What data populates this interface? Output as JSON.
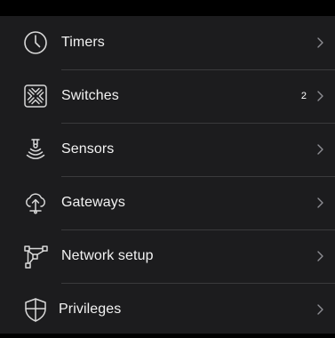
{
  "colors": {
    "background": "#1c1c1e",
    "text": "#f2f2f2",
    "icon": "#d8d8d8",
    "chevron": "#8e8e93",
    "divider": "#3a3a3c"
  },
  "menu": {
    "items": [
      {
        "label": "Timers",
        "icon": "clock-icon",
        "badge": ""
      },
      {
        "label": "Switches",
        "icon": "switch-icon",
        "badge": "2"
      },
      {
        "label": "Sensors",
        "icon": "sensor-icon",
        "badge": ""
      },
      {
        "label": "Gateways",
        "icon": "gateway-icon",
        "badge": ""
      },
      {
        "label": "Network setup",
        "icon": "network-icon",
        "badge": ""
      },
      {
        "label": "Privileges",
        "icon": "shield-icon",
        "badge": ""
      }
    ]
  }
}
